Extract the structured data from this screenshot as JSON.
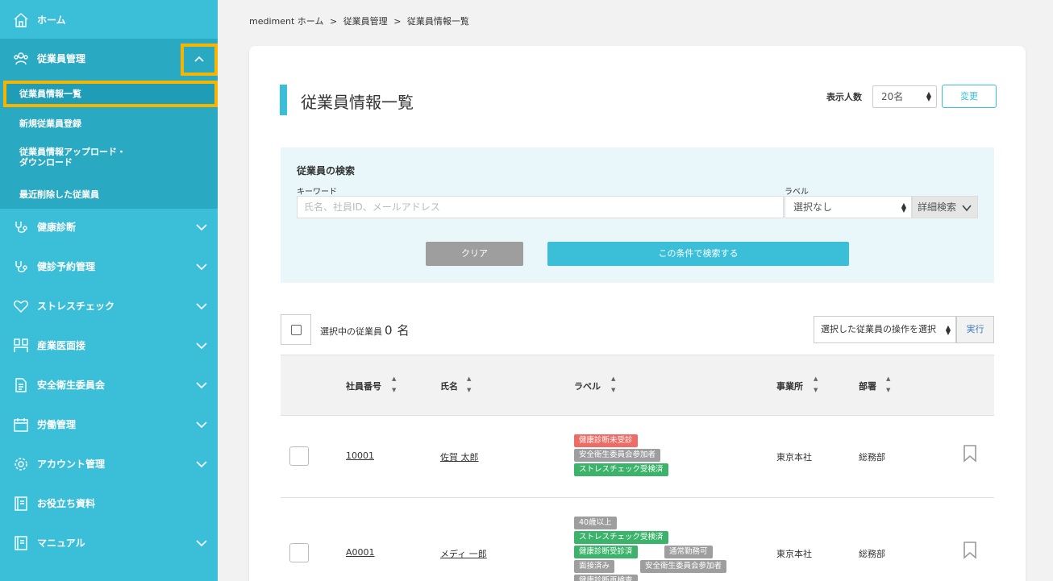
{
  "sidebar": {
    "home": "ホーム",
    "employee_mgmt": "従業員管理",
    "sub": [
      "従業員情報一覧",
      "新規従業員登録",
      "従業員情報アップロード・",
      "ダウンロード",
      "最近削除した従業員"
    ],
    "items": [
      "健康診断",
      "健診予約管理",
      "ストレスチェック",
      "産業医面接",
      "安全衛生委員会",
      "労働管理",
      "アカウント管理",
      "お役立ち資料",
      "マニュアル"
    ]
  },
  "breadcrumb": [
    "mediment ホーム",
    ">",
    "従業員管理",
    ">",
    "従業員情報一覧"
  ],
  "page": {
    "title": "従業員情報一覧",
    "per_label": "表示人数",
    "per_value": "20名",
    "change_btn": "変更"
  },
  "search": {
    "title": "従業員の検索",
    "keyword_label": "キーワード",
    "keyword_placeholder": "氏名、社員ID、メールアドレス",
    "label_label": "ラベル",
    "label_value": "選択なし",
    "advanced": "詳細検索",
    "clear": "クリア",
    "submit": "この条件で検索する"
  },
  "selection": {
    "prefix": "選択中の従業員",
    "count": "0",
    "suffix": "名",
    "op_placeholder": "選択した従業員の操作を選択",
    "exec": "実行"
  },
  "table": {
    "headers": [
      "社員番号",
      "氏名",
      "ラベル",
      "事業所",
      "部署"
    ],
    "rows": [
      {
        "id": "10001",
        "name": "佐賀 太郎",
        "office": "東京本社",
        "dept": "総務部",
        "tags": [
          "健康診断未受診",
          "安全衛生委員会参加者",
          "ストレスチェック受検済"
        ]
      },
      {
        "id": "A0001",
        "name": "メディ 一郎",
        "office": "東京本社",
        "dept": "総務部",
        "tags": [
          "40歳以上",
          "ストレスチェック受検済",
          "健康診断受診済",
          "通常勤務可",
          "面接済み",
          "安全衛生委員会参加者",
          "健康診断再検査"
        ]
      }
    ]
  },
  "colors": {
    "sidebar": "#3bbfd9",
    "highlight": "#f7b500",
    "tag_red": "#ef6b66",
    "tag_gray": "#9e9e9e",
    "tag_green": "#3bb36a"
  }
}
